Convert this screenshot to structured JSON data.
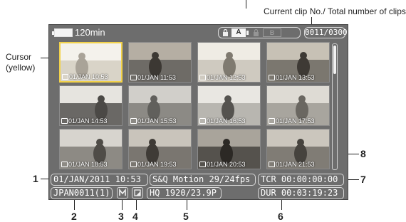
{
  "annotations": {
    "current_clip_label": "Current clip No./ Total number of clips",
    "cursor_label": "Cursor",
    "cursor_sublabel": "(yellow)",
    "numbers": [
      "1",
      "2",
      "3",
      "4",
      "5",
      "6",
      "7",
      "8"
    ]
  },
  "status_bar": {
    "battery_remaining": "120min",
    "slot_a_label": "A",
    "slot_b_label": "B",
    "clip_counter": "0011/0300"
  },
  "thumbnails": [
    {
      "caption": "01/JAN 10:53",
      "selected": true
    },
    {
      "caption": "01/JAN 11:53",
      "selected": false
    },
    {
      "caption": "01/JAN 12:53",
      "selected": false
    },
    {
      "caption": "01/JAN 13:53",
      "selected": false
    },
    {
      "caption": "01/JAN 14:53",
      "selected": false
    },
    {
      "caption": "01/JAN 15:53",
      "selected": false
    },
    {
      "caption": "01/JAN 16:53",
      "selected": false
    },
    {
      "caption": "01/JAN 17:53",
      "selected": false
    },
    {
      "caption": "01/JAN 18:53",
      "selected": false
    },
    {
      "caption": "01/JAN 19:53",
      "selected": false
    },
    {
      "caption": "01/JAN 20:53",
      "selected": false
    },
    {
      "caption": "01/JAN 21:53",
      "selected": false
    }
  ],
  "info": {
    "date_time": "01/JAN/2011 10:53",
    "clip_name": "JPAN0011(1)",
    "motion": "S&Q Motion 29/24fps",
    "video_format": "HQ 1920/23.9P",
    "timecode": "TCR 00:00:00:00",
    "duration": "DUR 00:03:19:23"
  },
  "colors": {
    "screen_bg": "#6d6d6d",
    "cursor": "#f2d24a",
    "pill_border": "#d8d8d8"
  }
}
